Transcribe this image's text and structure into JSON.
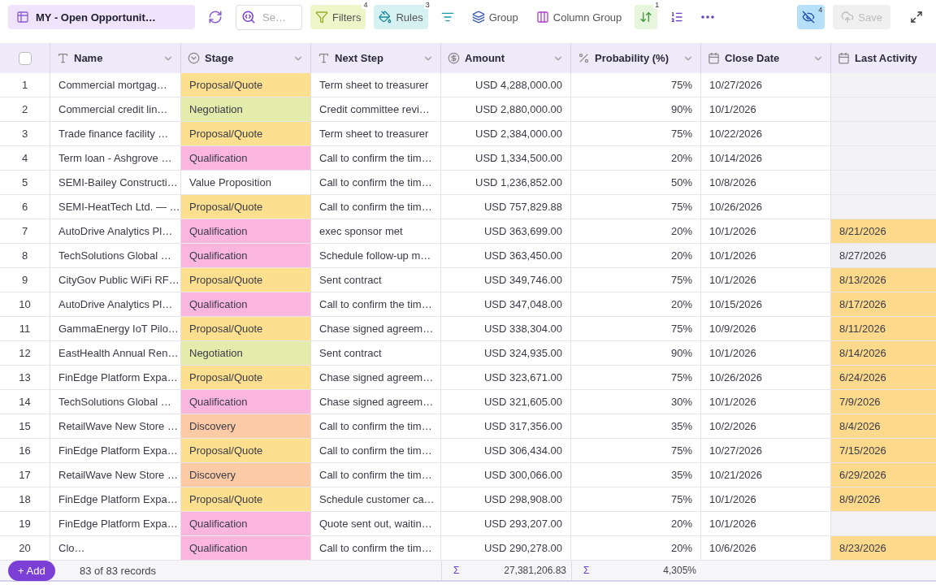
{
  "toolbar": {
    "view_title": "MY - Open Opportunit…",
    "search": {
      "placeholder": "Se…"
    },
    "tools": [
      {
        "kind": "filters",
        "label": "Filters",
        "badge": "4"
      },
      {
        "kind": "rules",
        "label": "Rules",
        "badge": "3"
      },
      {
        "kind": "smart-filter"
      },
      {
        "kind": "group",
        "label": "Group"
      },
      {
        "kind": "column-group",
        "label": "Column Group"
      },
      {
        "kind": "sort",
        "badge": "1"
      },
      {
        "kind": "row-height"
      },
      {
        "kind": "more"
      }
    ],
    "hidden_fields": {
      "badge": "4"
    },
    "save": {
      "label": "Save",
      "disabled": true
    }
  },
  "table": {
    "select_all": {
      "checked": false
    },
    "columns": [
      {
        "label": "Name",
        "kind": "text",
        "dropdown": true
      },
      {
        "label": "Stage",
        "kind": "select",
        "dropdown": true
      },
      {
        "label": "Next Step",
        "kind": "text",
        "dropdown": true
      },
      {
        "label": "Amount",
        "kind": "currency",
        "dropdown": true
      },
      {
        "label": "Probability (%)",
        "kind": "percent",
        "dropdown": true
      },
      {
        "label": "Close Date",
        "kind": "date",
        "dropdown": true
      },
      {
        "label": "Last Activity",
        "kind": "date",
        "dropdown": false
      }
    ],
    "rows": [
      {
        "num": "1",
        "name": "Commercial mortgag…",
        "stage": {
          "label": "Proposal/Quote",
          "color": "#fde08f"
        },
        "next_step": "Term sheet to treasurer",
        "amount": "USD 4,288,000.00",
        "probability": "75%",
        "close_date": "10/27/2026",
        "last_activity": {
          "color": "#f3f3f5"
        }
      },
      {
        "num": "2",
        "name": "Commercial credit lin…",
        "stage": {
          "label": "Negotiation",
          "color": "#e3ecaa"
        },
        "next_step": "Credit committee revi…",
        "amount": "USD 2,880,000.00",
        "probability": "90%",
        "close_date": "10/1/2026",
        "last_activity": {
          "color": "#f3f3f5"
        }
      },
      {
        "num": "3",
        "name": "Trade finance facility …",
        "stage": {
          "label": "Proposal/Quote",
          "color": "#fde08f"
        },
        "next_step": "Term sheet to treasurer",
        "amount": "USD 2,384,000.00",
        "probability": "75%",
        "close_date": "10/22/2026",
        "last_activity": {
          "color": "#f3f3f5"
        }
      },
      {
        "num": "4",
        "name": "Term loan - Ashgrove …",
        "stage": {
          "label": "Qualification",
          "color": "#fbb6de"
        },
        "next_step": "Call to confirm the tim…",
        "amount": "USD 1,334,500.00",
        "probability": "20%",
        "close_date": "10/14/2026",
        "last_activity": {
          "color": "#f3f3f5"
        }
      },
      {
        "num": "5",
        "name": "SEMI-Bailey Constructi…",
        "stage": {
          "label": "Value Proposition",
          "color": "#ffffff"
        },
        "next_step": "Call to confirm the tim…",
        "amount": "USD 1,236,852.00",
        "probability": "50%",
        "close_date": "10/8/2026",
        "last_activity": {
          "color": "#f3f3f5"
        }
      },
      {
        "num": "6",
        "name": "SEMI-HeatTech Ltd. — …",
        "stage": {
          "label": "Proposal/Quote",
          "color": "#fde08f"
        },
        "next_step": "Call to confirm the tim…",
        "amount": "USD 757,829.88",
        "probability": "75%",
        "close_date": "10/26/2026",
        "last_activity": {
          "color": "#f3f3f5"
        }
      },
      {
        "num": "7",
        "name": "AutoDrive Analytics Pl…",
        "stage": {
          "label": "Qualification",
          "color": "#fbb6de"
        },
        "next_step": "exec sponsor met",
        "amount": "USD 363,699.00",
        "probability": "20%",
        "close_date": "10/1/2026",
        "last_activity": {
          "date": "8/21/2026",
          "color": "#fcd98b"
        }
      },
      {
        "num": "8",
        "name": "TechSolutions Global …",
        "stage": {
          "label": "Qualification",
          "color": "#fbb6de"
        },
        "next_step": "Schedule follow-up m…",
        "amount": "USD 363,450.00",
        "probability": "20%",
        "close_date": "10/1/2026",
        "last_activity": {
          "date": "8/27/2026",
          "color": "#efeff1"
        }
      },
      {
        "num": "9",
        "name": "CityGov Public WiFi RF…",
        "stage": {
          "label": "Proposal/Quote",
          "color": "#fde08f"
        },
        "next_step": "Sent contract",
        "amount": "USD 349,746.00",
        "probability": "75%",
        "close_date": "10/1/2026",
        "last_activity": {
          "date": "8/13/2026",
          "color": "#fcd98b"
        }
      },
      {
        "num": "10",
        "name": "AutoDrive Analytics Pl…",
        "stage": {
          "label": "Qualification",
          "color": "#fbb6de"
        },
        "next_step": "Call to confirm the tim…",
        "amount": "USD 347,048.00",
        "probability": "20%",
        "close_date": "10/15/2026",
        "last_activity": {
          "date": "8/17/2026",
          "color": "#fcd98b"
        }
      },
      {
        "num": "11",
        "name": "GammaEnergy IoT Pilo…",
        "stage": {
          "label": "Proposal/Quote",
          "color": "#fde08f"
        },
        "next_step": "Chase signed agreem…",
        "amount": "USD 338,304.00",
        "probability": "75%",
        "close_date": "10/9/2026",
        "last_activity": {
          "date": "8/11/2026",
          "color": "#fcd98b"
        }
      },
      {
        "num": "12",
        "name": "EastHealth Annual Ren…",
        "stage": {
          "label": "Negotiation",
          "color": "#e3ecaa"
        },
        "next_step": "Sent contract",
        "amount": "USD 324,935.00",
        "probability": "90%",
        "close_date": "10/1/2026",
        "last_activity": {
          "date": "8/14/2026",
          "color": "#fcd98b"
        }
      },
      {
        "num": "13",
        "name": "FinEdge Platform Expa…",
        "stage": {
          "label": "Proposal/Quote",
          "color": "#fde08f"
        },
        "next_step": "Chase signed agreem…",
        "amount": "USD 323,671.00",
        "probability": "75%",
        "close_date": "10/26/2026",
        "last_activity": {
          "date": "6/24/2026",
          "color": "#fcd98b"
        }
      },
      {
        "num": "14",
        "name": "TechSolutions Global …",
        "stage": {
          "label": "Qualification",
          "color": "#fbb6de"
        },
        "next_step": "Chase signed agreem…",
        "amount": "USD 321,605.00",
        "probability": "30%",
        "close_date": "10/1/2026",
        "last_activity": {
          "date": "7/9/2026",
          "color": "#fcd98b"
        }
      },
      {
        "num": "15",
        "name": "RetailWave New Store …",
        "stage": {
          "label": "Discovery",
          "color": "#fdcaa6"
        },
        "next_step": "Call to confirm the tim…",
        "amount": "USD 317,356.00",
        "probability": "35%",
        "close_date": "10/2/2026",
        "last_activity": {
          "date": "8/4/2026",
          "color": "#fcd98b"
        }
      },
      {
        "num": "16",
        "name": "FinEdge Platform Expa…",
        "stage": {
          "label": "Proposal/Quote",
          "color": "#fde08f"
        },
        "next_step": "Call to confirm the tim…",
        "amount": "USD 306,434.00",
        "probability": "75%",
        "close_date": "10/27/2026",
        "last_activity": {
          "date": "7/15/2026",
          "color": "#fcd98b"
        }
      },
      {
        "num": "17",
        "name": "RetailWave New Store …",
        "stage": {
          "label": "Discovery",
          "color": "#fdcaa6"
        },
        "next_step": "Call to confirm the tim…",
        "amount": "USD 300,066.00",
        "probability": "35%",
        "close_date": "10/21/2026",
        "last_activity": {
          "date": "6/29/2026",
          "color": "#fcd98b"
        }
      },
      {
        "num": "18",
        "name": "FinEdge Platform Expa…",
        "stage": {
          "label": "Proposal/Quote",
          "color": "#fde08f"
        },
        "next_step": "Schedule customer ca…",
        "amount": "USD 298,908.00",
        "probability": "75%",
        "close_date": "10/1/2026",
        "last_activity": {
          "date": "8/9/2026",
          "color": "#fcd98b"
        }
      },
      {
        "num": "19",
        "name": "FinEdge Platform Expa…",
        "stage": {
          "label": "Qualification",
          "color": "#fbb6de"
        },
        "next_step": "Quote sent out, waitin…",
        "amount": "USD 293,207.00",
        "probability": "20%",
        "close_date": "10/1/2026",
        "last_activity": {
          "color": "#f3f3f5"
        }
      },
      {
        "num": "20",
        "name": "Clo…",
        "stage": {
          "label": "Qualification",
          "color": "#fbb6de"
        },
        "next_step": "Call to confirm the tim…",
        "amount": "USD 290,278.00",
        "probability": "20%",
        "close_date": "10/6/2026",
        "last_activity": {
          "date": "8/23/2026",
          "color": "#fcd98b"
        }
      }
    ]
  },
  "footer": {
    "add_label": "+ Add",
    "record_count": "83 of 83 records",
    "sums": [
      {
        "symbol": "Σ",
        "value": "27,381,206.83"
      },
      {
        "symbol": "Σ",
        "value": "4,305%"
      }
    ]
  }
}
